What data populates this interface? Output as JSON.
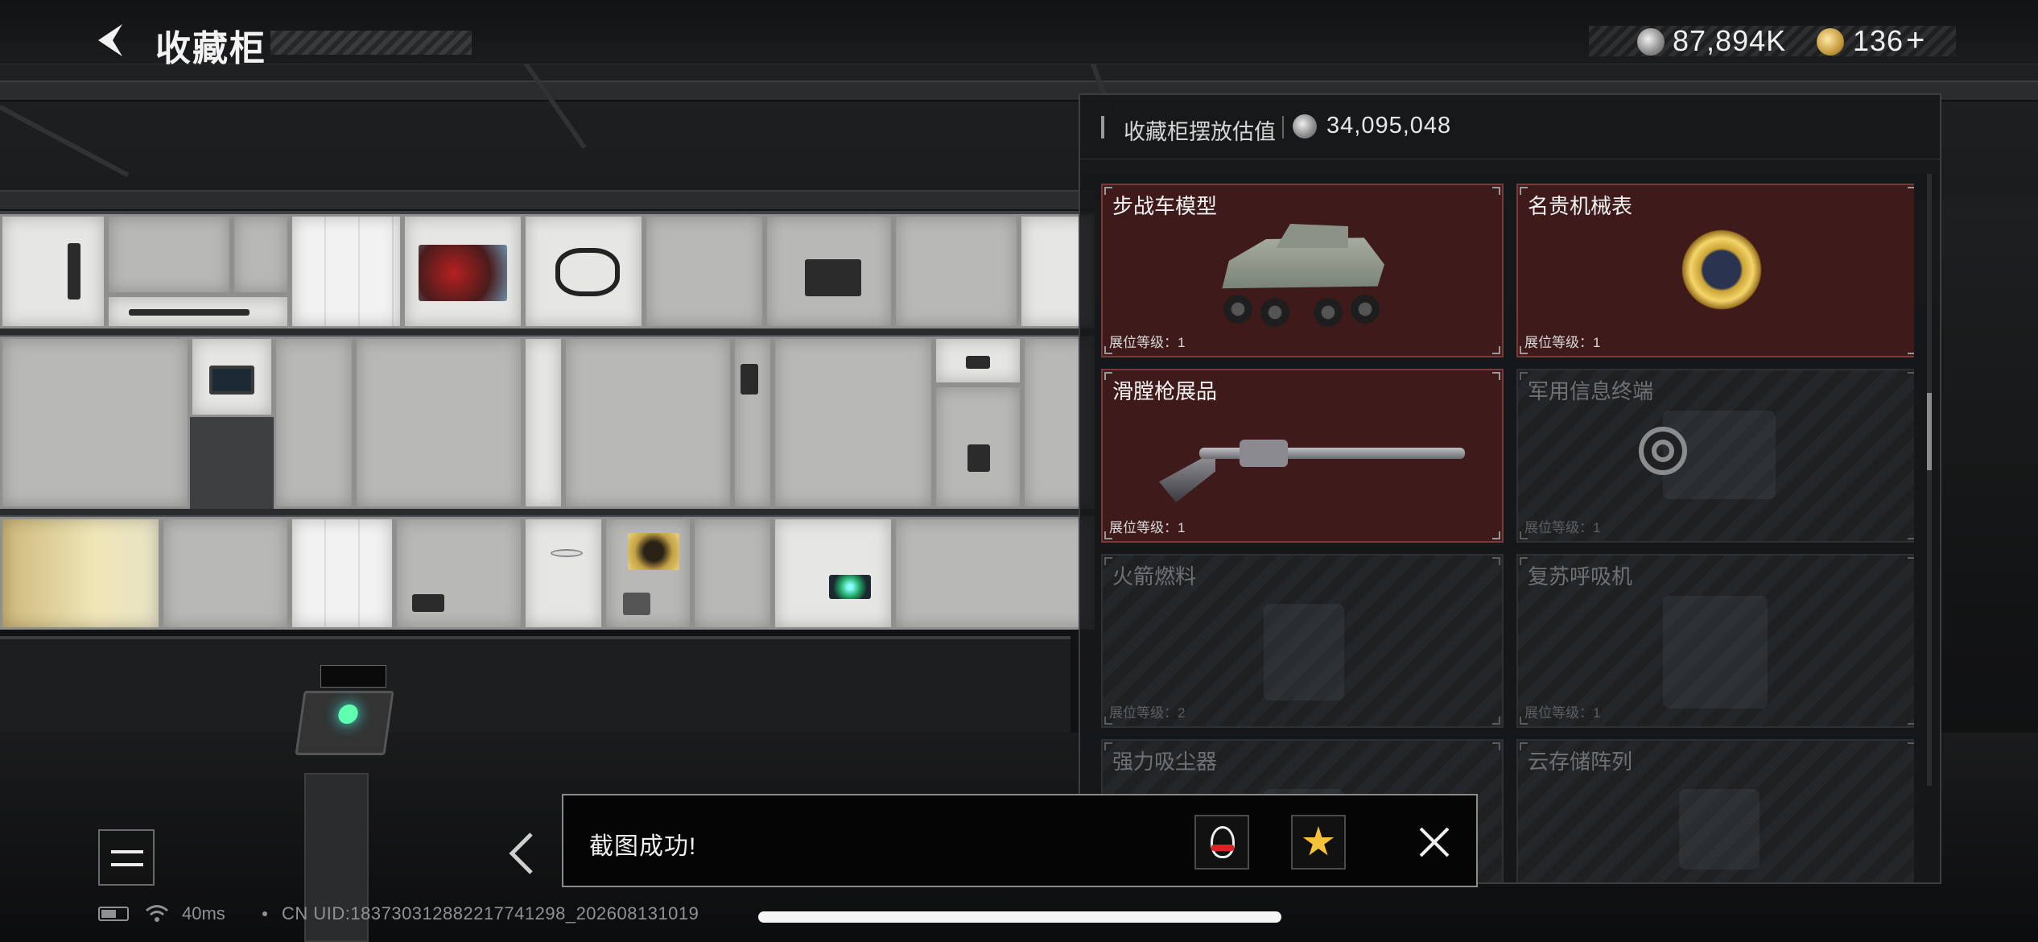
{
  "header": {
    "title": "收藏柜",
    "silver_amount": "87,894K",
    "gold_amount": "136",
    "add_label": "+"
  },
  "panel": {
    "value_label": "收藏柜摆放估值",
    "value_amount": "34,095,048",
    "items": [
      {
        "name": "步战车模型",
        "level": "展位等级：1",
        "state": "unlocked",
        "icon": "apc-model-icon"
      },
      {
        "name": "名贵机械表",
        "level": "展位等级：1",
        "state": "unlocked",
        "icon": "luxury-watch-icon"
      },
      {
        "name": "滑膛枪展品",
        "level": "展位等级：1",
        "state": "unlocked",
        "icon": "musket-icon"
      },
      {
        "name": "军用信息终端",
        "level": "展位等级：1",
        "state": "locked",
        "icon": "locked-target-icon"
      },
      {
        "name": "火箭燃料",
        "level": "展位等级：2",
        "state": "locked",
        "icon": "rocket-fuel-icon"
      },
      {
        "name": "复苏呼吸机",
        "level": "展位等级：1",
        "state": "locked",
        "icon": "ventilator-icon"
      },
      {
        "name": "强力吸尘器",
        "level": "",
        "state": "locked",
        "icon": "vacuum-icon"
      },
      {
        "name": "云存储阵列",
        "level": "",
        "state": "locked",
        "icon": "cloud-array-icon"
      }
    ]
  },
  "toast": {
    "message": "截图成功!",
    "share_targets": [
      "qq-icon",
      "qzone-icon"
    ]
  },
  "status_bar": {
    "ping": "40ms",
    "uid": "CN UID:18373031288221774129​8_202608131019"
  },
  "colors": {
    "unlocked_card_bg": "#3f1a1a",
    "locked_card_bg": "#1e2022",
    "panel_bg": "#16181a",
    "accent_gold": "#c49a3c",
    "toast_bg": "#050505"
  }
}
